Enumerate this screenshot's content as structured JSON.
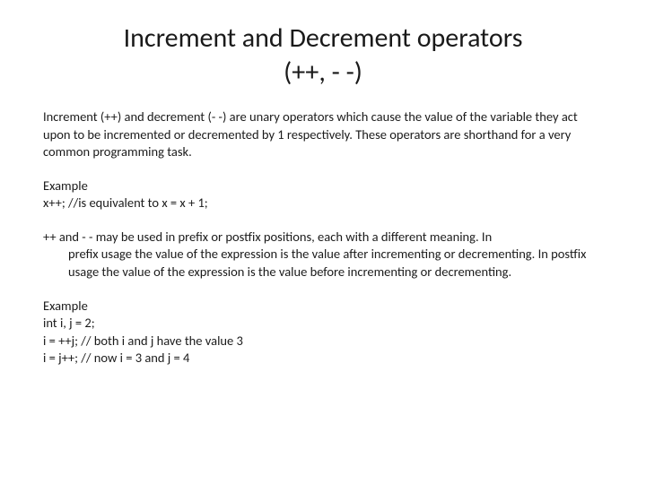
{
  "title_line1": "Increment and Decrement operators",
  "title_line2": "(++, - -)",
  "para1": "Increment (++) and decrement (- -) are unary operators which cause the value of the variable they act upon to be incremented or decremented by 1 respectively. These operators are shorthand for a very common programming task.",
  "example1_label": "Example",
  "example1_code": "x++; //is equivalent to x = x + 1;",
  "para2_lead": "++ and - - may be used in prefix or postfix positions, each with a different meaning. In",
  "para2_rest": "prefix usage the value of the expression is the value after incrementing or decrementing. In postfix usage the value of the expression is the value before incrementing or decrementing.",
  "example2_label": "Example",
  "example2_line1": "int i, j = 2;",
  "example2_line2": "i = ++j; // both i and j have the value 3",
  "example2_line3": "i = j++; // now i = 3 and j = 4"
}
